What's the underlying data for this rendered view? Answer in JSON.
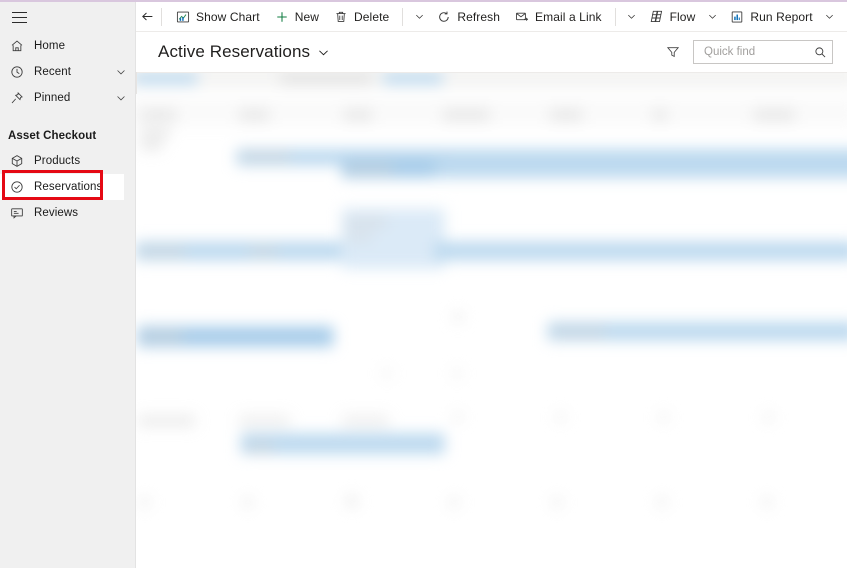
{
  "theme": {
    "accent_border": "#d9c7de",
    "sidebar_bg": "#f0f0f0",
    "highlight_rect": "#e50914",
    "selection_blue": "#bcd9ef",
    "new_icon_green": "#107c41"
  },
  "sidebar": {
    "menu_button": "Site map",
    "items": [
      {
        "label": "Home",
        "icon": "home-icon",
        "expandable": false
      },
      {
        "label": "Recent",
        "icon": "clock-icon",
        "expandable": true
      },
      {
        "label": "Pinned",
        "icon": "pin-icon",
        "expandable": true
      }
    ],
    "group_title": "Asset Checkout",
    "entities": [
      {
        "label": "Products",
        "icon": "product-box-icon",
        "selected": false
      },
      {
        "label": "Reservations",
        "icon": "check-circle-icon",
        "selected": true
      },
      {
        "label": "Reviews",
        "icon": "comment-icon",
        "selected": false
      }
    ]
  },
  "command_bar": {
    "back_label": "Back",
    "buttons": [
      {
        "label": "Show Chart",
        "icon": "chart-icon",
        "caret": false
      },
      {
        "label": "New",
        "icon": "plus-icon",
        "caret": false
      },
      {
        "label": "Delete",
        "icon": "trash-icon",
        "caret": true
      },
      {
        "label": "Refresh",
        "icon": "refresh-icon",
        "caret": false
      },
      {
        "label": "Email a Link",
        "icon": "email-icon",
        "caret": true
      },
      {
        "label": "Flow",
        "icon": "flow-icon",
        "caret": true
      },
      {
        "label": "Run Report",
        "icon": "report-icon",
        "caret": true
      }
    ],
    "overflow_label": "More commands"
  },
  "view_header": {
    "title": "Active Reservations",
    "title_caret_label": "Change view",
    "filter_label": "Edit filters",
    "search": {
      "placeholder": "Quick find",
      "value": "",
      "search_icon_label": "Search"
    }
  },
  "grid": {
    "state": "redacted",
    "note": "Record grid content is blurred/obscured in the screenshot; no cell values are legible."
  }
}
